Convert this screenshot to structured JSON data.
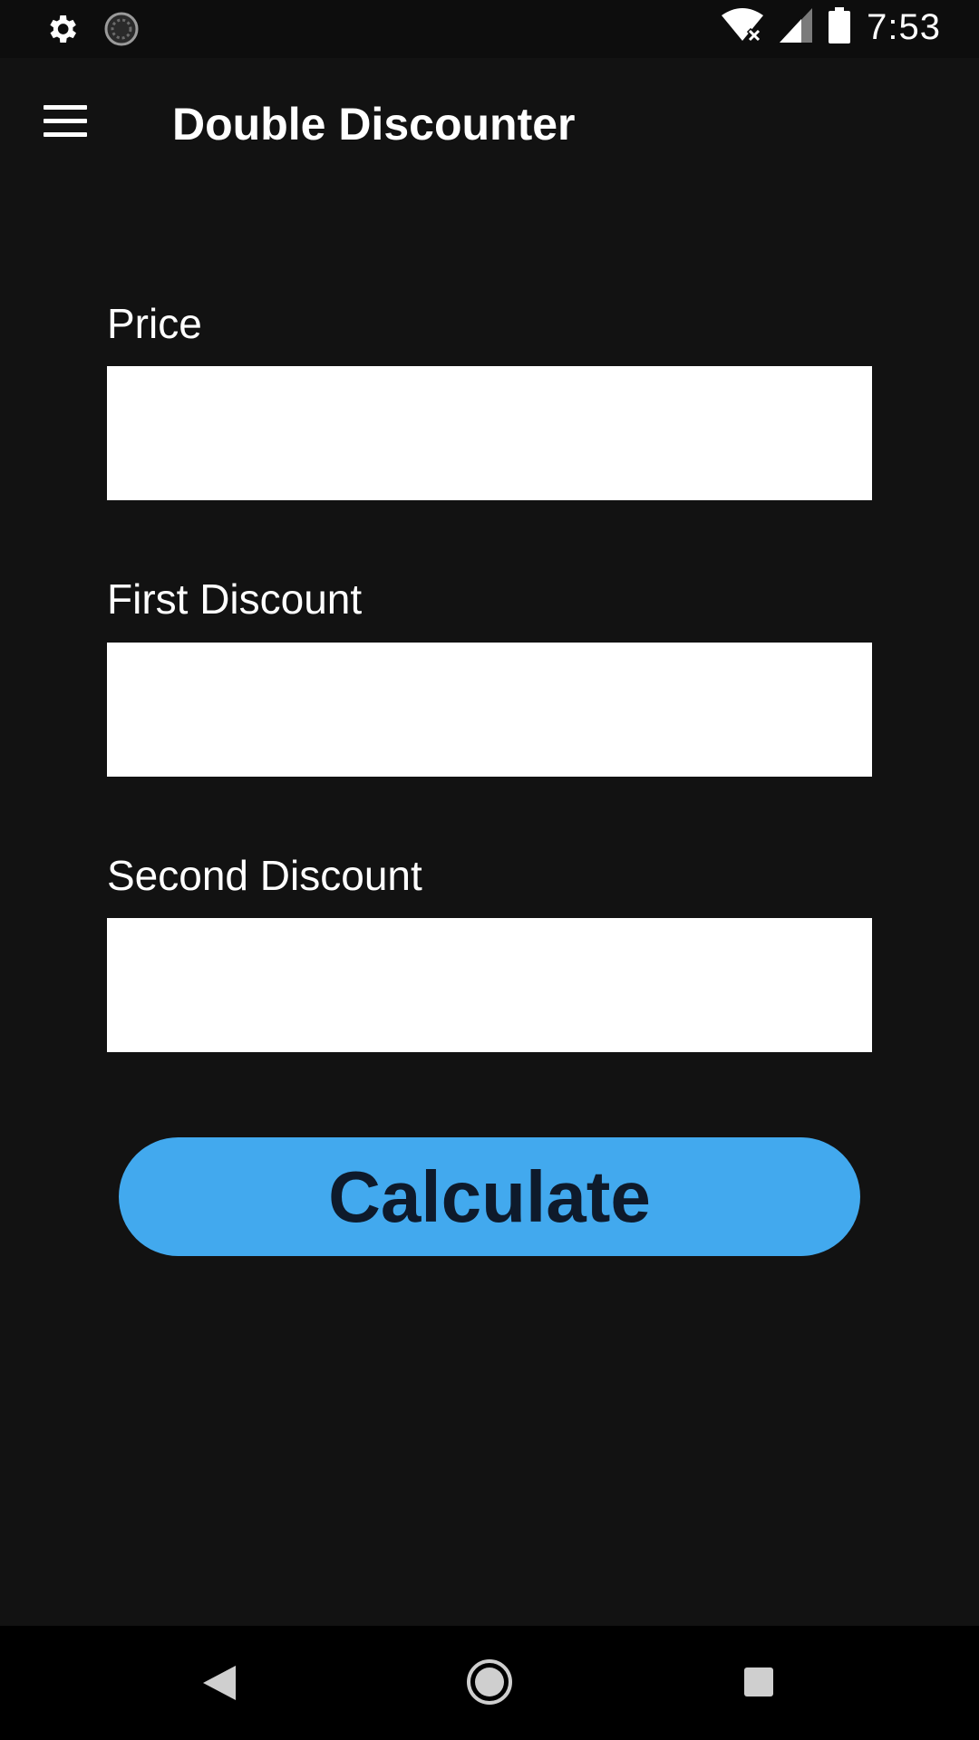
{
  "status_bar": {
    "time": "7:53",
    "icons": [
      "settings-icon",
      "sync-icon",
      "wifi-icon",
      "signal-icon",
      "battery-icon"
    ]
  },
  "app_bar": {
    "title": "Double Discounter",
    "menu_icon": "hamburger-menu-icon"
  },
  "form": {
    "price_label": "Price",
    "price_value": "",
    "first_discount_label": "First Discount",
    "first_discount_value": "",
    "second_discount_label": "Second Discount",
    "second_discount_value": ""
  },
  "calculate_button": {
    "label": "Calculate",
    "color": "#42a9ee"
  },
  "nav_bar": {
    "icons": [
      "back-icon",
      "home-icon",
      "recent-apps-icon"
    ]
  },
  "colors": {
    "background": "#121212",
    "accent": "#42a9ee",
    "input_background": "#ffffff"
  }
}
